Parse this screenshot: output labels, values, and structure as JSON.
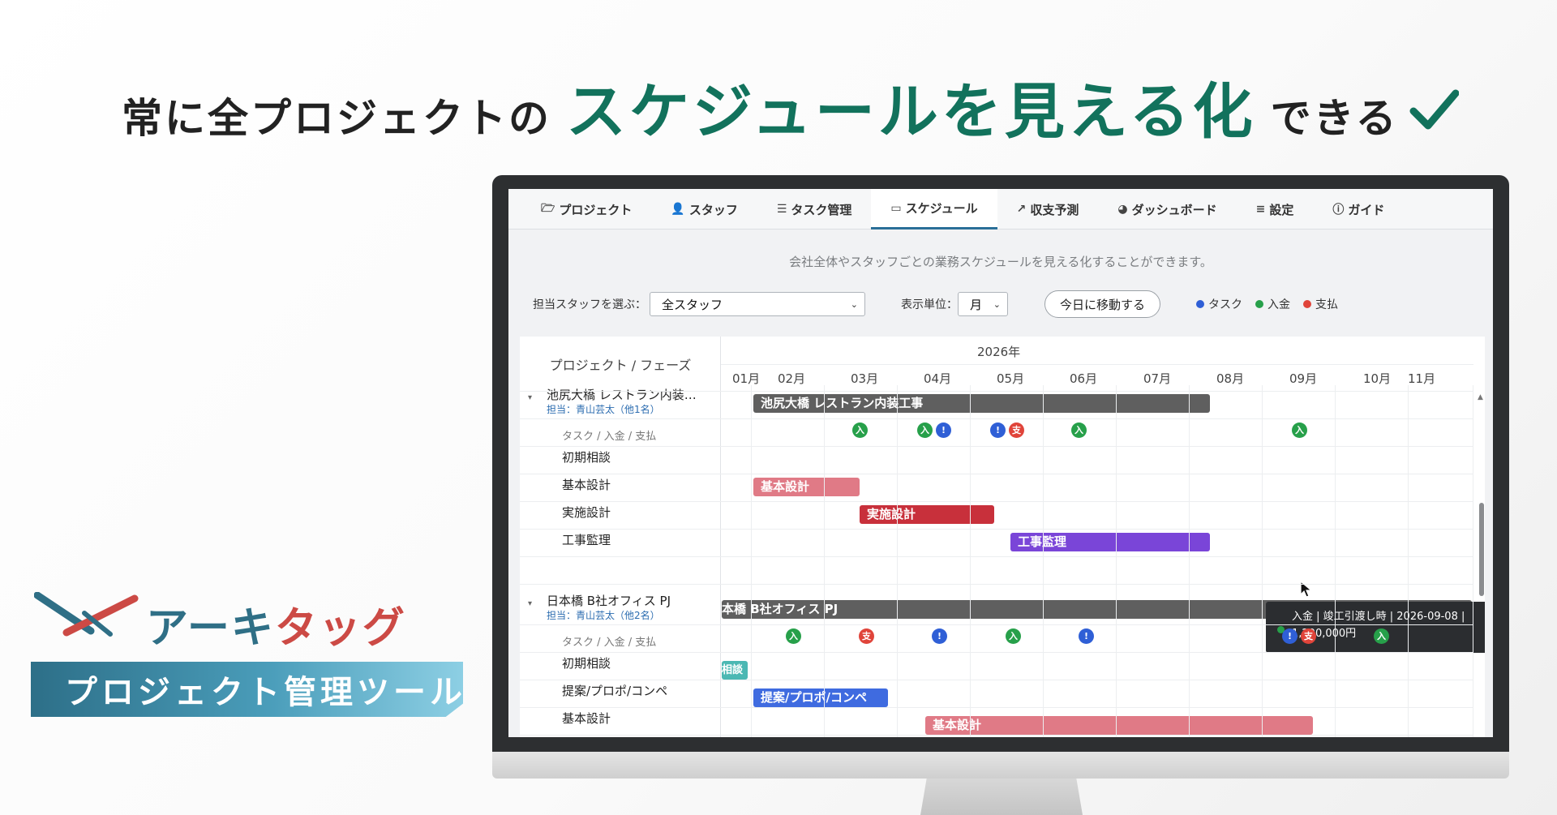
{
  "headline": {
    "prefix": "常に全プロジェクトの",
    "emphasis": "スケジュールを見える化",
    "suffix": "できる"
  },
  "brand": {
    "name_part1": "アーキ",
    "name_part2": "タッグ",
    "banner": "プロジェクト管理ツール",
    "accent_blue": "#2f6f86",
    "accent_red": "#cc4a45"
  },
  "app": {
    "tabs": [
      {
        "label": "プロジェクト",
        "icon": "folder-icon",
        "glyph": "🗁",
        "active": false
      },
      {
        "label": "スタッフ",
        "icon": "user-gear-icon",
        "glyph": "👤",
        "active": false
      },
      {
        "label": "タスク管理",
        "icon": "list-check-icon",
        "glyph": "☰",
        "active": false
      },
      {
        "label": "スケジュール",
        "icon": "calendar-icon",
        "glyph": "▭",
        "active": true
      },
      {
        "label": "収支予測",
        "icon": "line-chart-icon",
        "glyph": "↗",
        "active": false
      },
      {
        "label": "ダッシュボード",
        "icon": "pie-chart-icon",
        "glyph": "◕",
        "active": false
      },
      {
        "label": "設定",
        "icon": "sliders-icon",
        "glyph": "≡",
        "active": false
      },
      {
        "label": "ガイド",
        "icon": "question-circle-icon",
        "glyph": "ⓘ",
        "active": false
      }
    ],
    "subtitle": "会社全体やスタッフごとの業務スケジュールを見える化することができます。",
    "controls": {
      "staff_label": "担当スタッフを選ぶ：",
      "staff_value": "全スタッフ",
      "unit_label": "表示単位：",
      "unit_value": "月",
      "today_button": "今日に移動する"
    },
    "legend": [
      {
        "label": "タスク",
        "color": "#2f5fd6"
      },
      {
        "label": "入金",
        "color": "#27a04a"
      },
      {
        "label": "支払",
        "color": "#e0443a"
      }
    ]
  },
  "gantt": {
    "left_header": "プロジェクト / フェーズ",
    "year": "2026年",
    "months": [
      "01月",
      "02月",
      "03月",
      "04月",
      "05月",
      "06月",
      "07月",
      "08月",
      "09月",
      "10月",
      "11月"
    ],
    "projects": [
      {
        "title": "池尻大橋 レストラン内装…",
        "owner": "担当：青山芸太（他1名）",
        "bar_label": "池尻大橋 レストラン内装工事",
        "task_row_label": "タスク / 入金 / 支払",
        "phases": [
          "初期相談",
          "基本設計",
          "実施設計",
          "工事監理"
        ],
        "phase_bars": [
          "基本設計",
          "実施設計",
          "工事監理"
        ]
      },
      {
        "title": "日本橋 B社オフィス PJ",
        "owner": "担当：青山芸太（他2名）",
        "bar_label": "本橋 B社オフィス PJ",
        "task_row_label": "タスク / 入金 / 支払",
        "phases": [
          "初期相談",
          "提案/プロポ/コンペ",
          "基本設計"
        ],
        "phase_bars": [
          "相談",
          "提案/プロポ/コンペ",
          "基本設計"
        ]
      }
    ],
    "marker_glyphs": {
      "task": "!",
      "income": "入",
      "payment": "支"
    },
    "bar_colors": {
      "project": "#5f5f5f",
      "kihon": "#e07a86",
      "jisshi": "#c8303b",
      "kanri": "#7a45d8",
      "shodan": "#4bb8b3",
      "teian": "#3f6be0"
    },
    "tooltip": {
      "line1": "入金 | 竣工引渡し時 | 2026-09-08 |",
      "line2": "1,200,000円"
    }
  }
}
